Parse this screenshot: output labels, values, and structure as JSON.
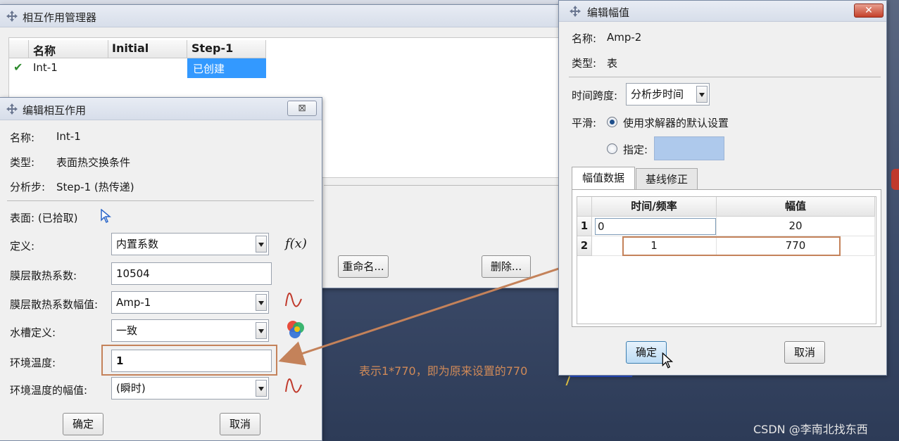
{
  "manager": {
    "title": "相互作用管理器",
    "columns": [
      "名称",
      "Initial",
      "Step-1"
    ],
    "row": {
      "check": "✔",
      "name": "Int-1",
      "initial": "",
      "step1": "已创建"
    },
    "rename_label": "重命名...",
    "delete_label": "删除..."
  },
  "edit_interaction": {
    "title": "编辑相互作用",
    "close": "⊠",
    "name_label": "名称:",
    "name_value": "Int-1",
    "type_label": "类型:",
    "type_value": "表面热交换条件",
    "step_label": "分析步:",
    "step_value": "Step-1 (热传递)",
    "surface_label": "表面: (已拾取)",
    "definition_label": "定义:",
    "definition_value": "内置系数",
    "fx_label": "f(x)",
    "film_coeff_label": "膜层散热系数:",
    "film_coeff_value": "10504",
    "film_amp_label": "膜层散热系数幅值:",
    "film_amp_value": "Amp-1",
    "sink_def_label": "水槽定义:",
    "sink_def_value": "一致",
    "sink_temp_label": "环境温度:",
    "sink_temp_value": "1",
    "sink_amp_label": "环境温度的幅值:",
    "sink_amp_value": "(瞬时)",
    "ok_label": "确定",
    "cancel_label": "取消"
  },
  "edit_amplitude": {
    "title": "编辑幅值",
    "close": "✕",
    "name_label": "名称:",
    "name_value": "Amp-2",
    "type_label": "类型:",
    "type_value": "表",
    "time_span_label": "时间跨度:",
    "time_span_value": "分析步时间",
    "smoothing_label": "平滑:",
    "smooth_default_label": "使用求解器的默认设置",
    "smooth_specify_label": "指定:",
    "tabs": [
      "幅值数据",
      "基线修正"
    ],
    "columns": [
      "时间/频率",
      "幅值"
    ],
    "rows": [
      {
        "index": "1",
        "time": "0",
        "amp": "20"
      },
      {
        "index": "2",
        "time": "1",
        "amp": "770"
      }
    ],
    "ok_label": "确定",
    "cancel_label": "取消"
  },
  "annotation": "表示1*770，即为原来设置的770",
  "watermark": "CSDN @李南北找东西",
  "colors": {
    "accent": "#c4825a",
    "selection": "#3399ff"
  }
}
